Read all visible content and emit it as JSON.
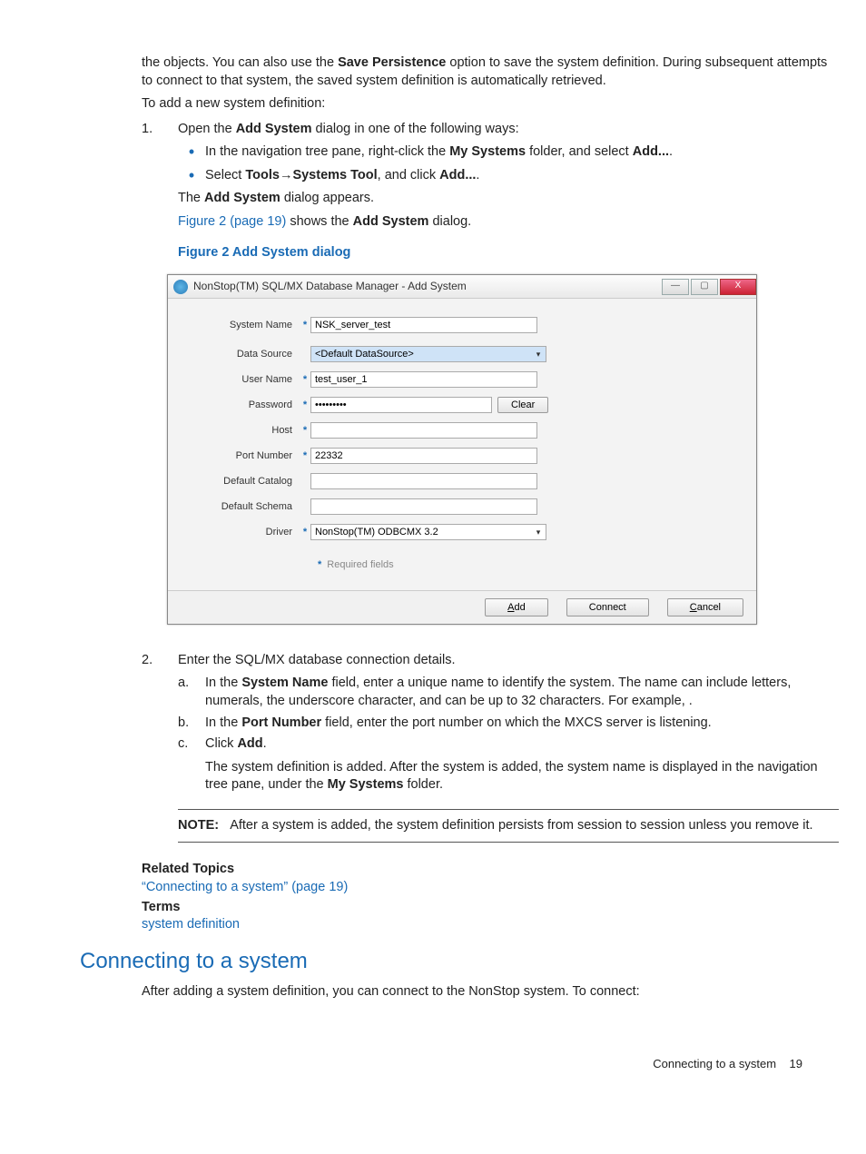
{
  "doc": {
    "intro1_a": "the objects. You can also use the ",
    "intro1_b": "Save Persistence",
    "intro1_c": " option to save the system definition. During subsequent attempts to connect to that system, the saved system definition is automatically retrieved.",
    "intro2": "To add a new system definition:",
    "step1_num": "1.",
    "step1_a": "Open the ",
    "step1_b": "Add System",
    "step1_c": " dialog in one of the following ways:",
    "bullet1_a": "In the navigation tree pane, right-click the ",
    "bullet1_b": "My Systems",
    "bullet1_c": " folder, and select ",
    "bullet1_d": "Add...",
    "bullet1_e": ".",
    "bullet2_a": "Select ",
    "bullet2_b": "Tools",
    "bullet2_arrow": "→",
    "bullet2_c": "Systems Tool",
    "bullet2_d": ", and click ",
    "bullet2_e": "Add...",
    "bullet2_f": ".",
    "after_bullets_a": "The ",
    "after_bullets_b": "Add System",
    "after_bullets_c": " dialog appears.",
    "fig_ref": "Figure 2 (page 19)",
    "fig_ref_a": " shows the ",
    "fig_ref_b": "Add System",
    "fig_ref_c": " dialog.",
    "fig_caption": "Figure 2 Add System dialog",
    "step2_num": "2.",
    "step2_txt": "Enter the SQL/MX database connection details.",
    "sub_a_let": "a.",
    "sub_a_1": "In the ",
    "sub_a_2": "System Name",
    "sub_a_3": " field, enter a unique name to identify the system. The name can include letters, numerals, the underscore character, and can be up to 32 characters. For example,                                 .",
    "sub_b_let": "b.",
    "sub_b_1": "In the ",
    "sub_b_2": "Port Number",
    "sub_b_3": " field, enter the port number on which the MXCS server is listening.",
    "sub_c_let": "c.",
    "sub_c_1": "Click ",
    "sub_c_2": "Add",
    "sub_c_3": ".",
    "sub_c_p": "The system definition is added. After the system is added, the system name is displayed in the navigation tree pane, under the ",
    "sub_c_p2": "My Systems",
    "sub_c_p3": " folder.",
    "note_lbl": "NOTE:",
    "note_txt": "After a system is added, the system definition persists from session to session unless you remove it.",
    "related_heading": "Related Topics",
    "related_link": "“Connecting to a system” (page 19)",
    "terms_heading": "Terms",
    "terms_link": "system definition",
    "section": "Connecting to a system",
    "section_p": "After adding a system definition, you can connect to the NonStop system. To connect:",
    "footer_txt": "Connecting to a system",
    "footer_page": "19"
  },
  "dialog": {
    "title": "NonStop(TM) SQL/MX Database Manager - Add System",
    "labels": {
      "system_name": "System Name",
      "data_source": "Data Source",
      "user_name": "User Name",
      "password": "Password",
      "host": "Host",
      "port": "Port Number",
      "catalog": "Default Catalog",
      "schema": "Default Schema",
      "driver": "Driver"
    },
    "values": {
      "system_name": "NSK_server_test",
      "data_source": "<Default DataSource>",
      "user_name": "test_user_1",
      "password": "•••••••••",
      "host": "",
      "port": "22332",
      "catalog": "",
      "schema": "",
      "driver": "NonStop(TM) ODBCMX 3.2"
    },
    "buttons": {
      "clear": "Clear",
      "add": "Add",
      "connect": "Connect",
      "cancel": "Cancel"
    },
    "required_note": "Required fields",
    "star": "*"
  }
}
